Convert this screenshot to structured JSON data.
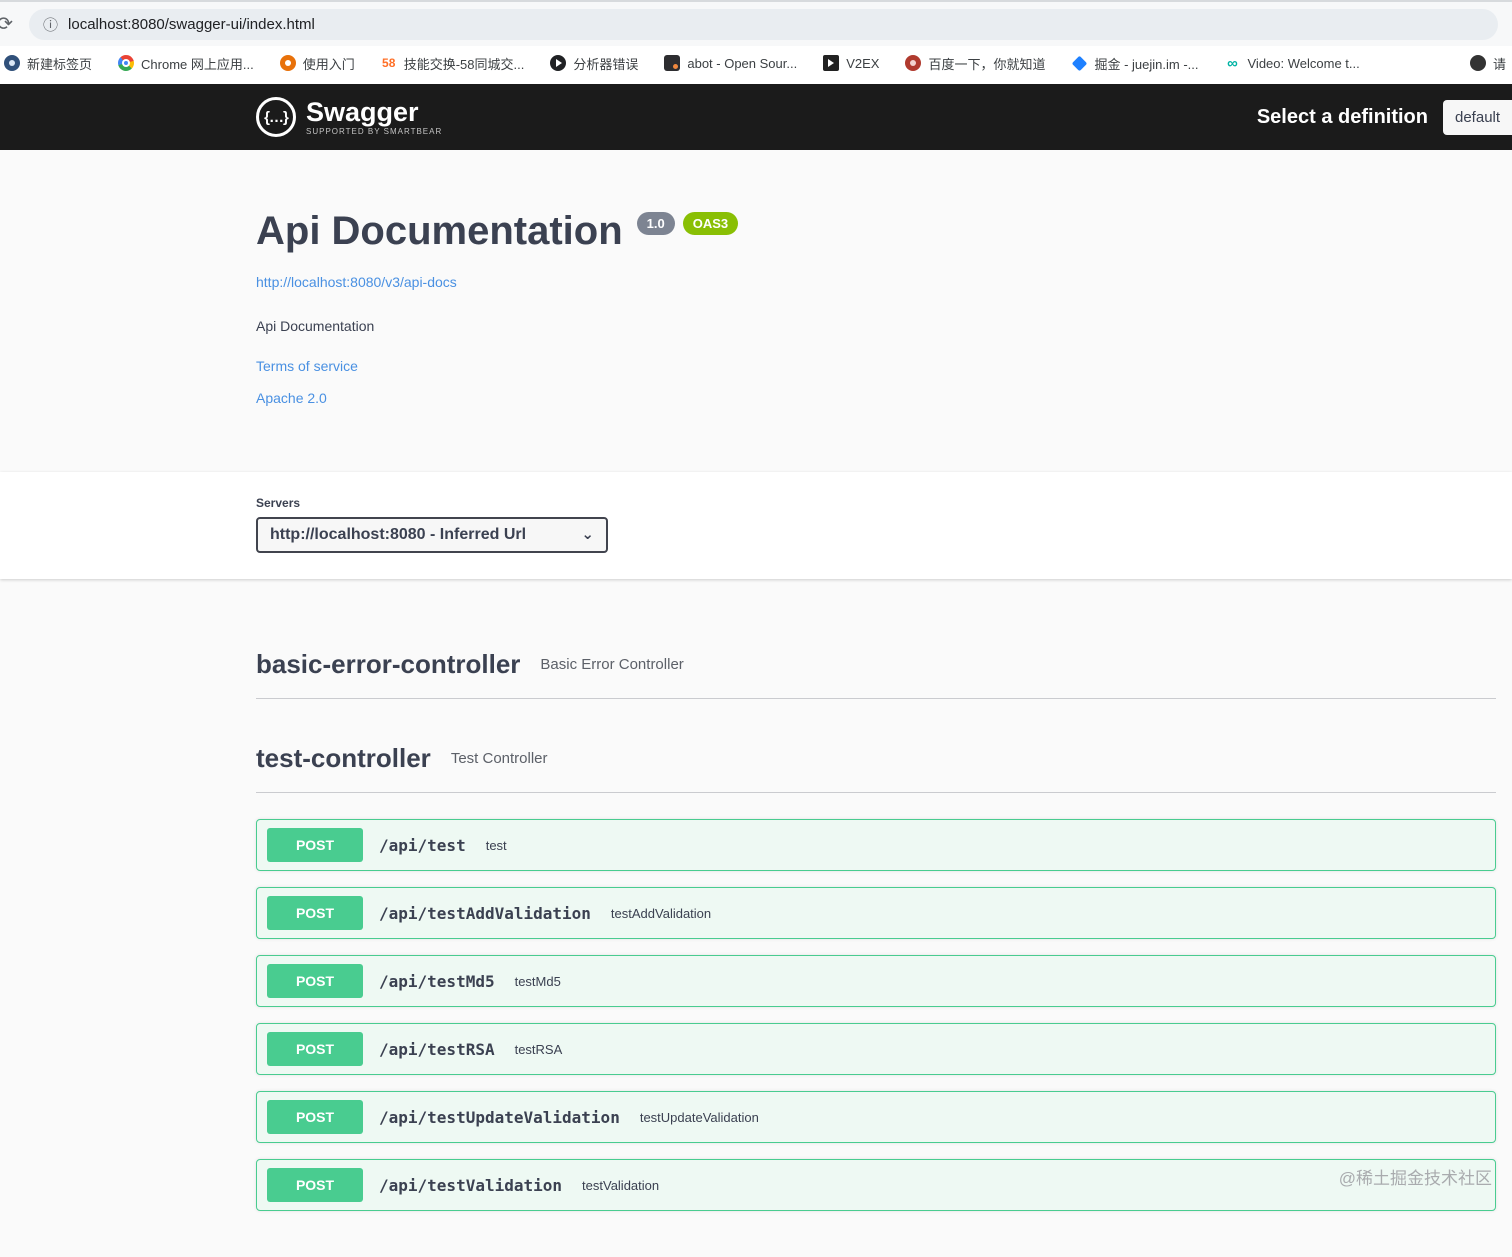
{
  "glyphs": {
    "reload": "⟳",
    "info": "ⓘ",
    "braces": "{…}",
    "caret_down": "⌄",
    "select_caret": "▾",
    "infinity": "∞"
  },
  "browser": {
    "url": "localhost:8080/swagger-ui/index.html",
    "bookmarks": [
      {
        "label": "新建标签页"
      },
      {
        "label": "Chrome 网上应用..."
      },
      {
        "label": "使用入门"
      },
      {
        "label": "技能交换-58同城交...",
        "badge": "58"
      },
      {
        "label": "分析器错误"
      },
      {
        "label": "abot - Open Sour..."
      },
      {
        "label": "V2EX"
      },
      {
        "label": "百度一下，你就知道"
      },
      {
        "label": "掘金 - juejin.im -..."
      },
      {
        "label": "Video: Welcome t..."
      },
      {
        "label": "请"
      }
    ]
  },
  "topbar": {
    "logo_text": "Swagger",
    "logo_sub": "SUPPORTED BY SMARTBEAR",
    "select_label": "Select a definition",
    "select_value": "default"
  },
  "info": {
    "title": "Api Documentation",
    "version": "1.0",
    "oas": "OAS3",
    "spec_link": "http://localhost:8080/v3/api-docs",
    "description": "Api Documentation",
    "terms_link": "Terms of service",
    "license_link": "Apache 2.0"
  },
  "servers": {
    "label": "Servers",
    "value": "http://localhost:8080 - Inferred Url"
  },
  "tags": [
    {
      "name": "basic-error-controller",
      "description": "Basic Error Controller"
    },
    {
      "name": "test-controller",
      "description": "Test Controller"
    }
  ],
  "operations": [
    {
      "method": "POST",
      "path": "/api/test",
      "summary": "test"
    },
    {
      "method": "POST",
      "path": "/api/testAddValidation",
      "summary": "testAddValidation"
    },
    {
      "method": "POST",
      "path": "/api/testMd5",
      "summary": "testMd5"
    },
    {
      "method": "POST",
      "path": "/api/testRSA",
      "summary": "testRSA"
    },
    {
      "method": "POST",
      "path": "/api/testUpdateValidation",
      "summary": "testUpdateValidation"
    },
    {
      "method": "POST",
      "path": "/api/testValidation",
      "summary": "testValidation"
    }
  ],
  "watermark": "@稀土掘金技术社区",
  "colors": {
    "post_green": "#49cc90",
    "post_row_bg": "#eef9f3",
    "topbar_bg": "#1b1b1b",
    "link_blue": "#4990e2",
    "version_badge": "#7d8492",
    "oas_badge": "#89bf04"
  }
}
